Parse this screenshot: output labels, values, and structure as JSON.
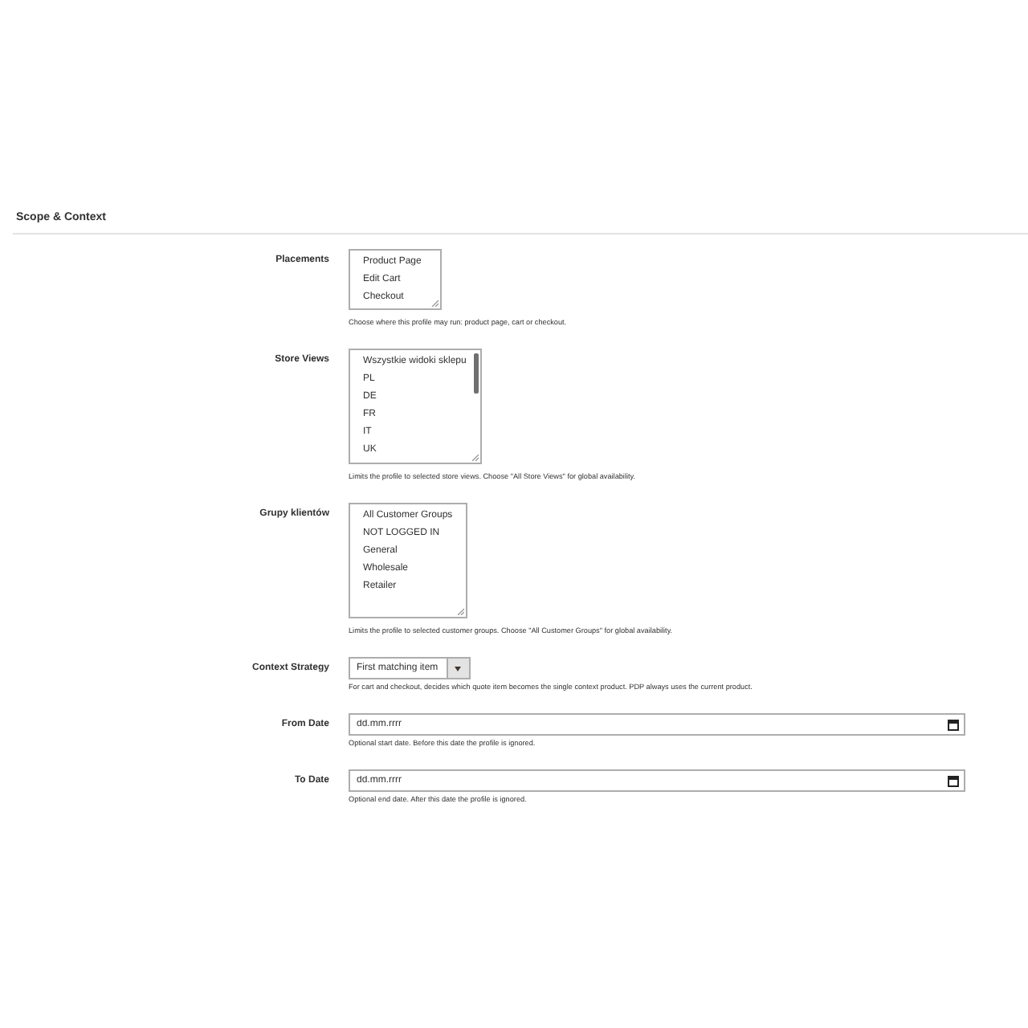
{
  "section": {
    "title": "Scope & Context"
  },
  "fields": [
    {
      "kind": "multiselect",
      "label": "Placements",
      "scrollable": false,
      "options": [
        {
          "label": "Product Page",
          "selected": false
        },
        {
          "label": "Edit Cart",
          "selected": false
        },
        {
          "label": "Checkout",
          "selected": false
        }
      ],
      "note": "Choose where this profile may run: product page, cart or checkout."
    },
    {
      "kind": "multiselect",
      "label": "Store Views",
      "scrollable": true,
      "options": [
        {
          "label": "Wszystkie widoki sklepu",
          "selected": false
        },
        {
          "label": "PL",
          "selected": false
        },
        {
          "label": "DE",
          "selected": false
        },
        {
          "label": "FR",
          "selected": false
        },
        {
          "label": "IT",
          "selected": false
        },
        {
          "label": "UK",
          "selected": false
        }
      ],
      "note": "Limits the profile to selected store views. Choose \"All Store Views\" for global availability."
    },
    {
      "kind": "multiselect",
      "label": "Grupy klientów",
      "scrollable": false,
      "options": [
        {
          "label": "All Customer Groups",
          "selected": false
        },
        {
          "label": "NOT LOGGED IN",
          "selected": false
        },
        {
          "label": "General",
          "selected": false
        },
        {
          "label": "Wholesale",
          "selected": false
        },
        {
          "label": "Retailer",
          "selected": false
        }
      ],
      "note": "Limits the profile to selected customer groups. Choose \"All Customer Groups\" for global availability."
    },
    {
      "kind": "select",
      "label": "Context Strategy",
      "value": "First matching item",
      "note": "For cart and checkout, decides which quote item becomes the single context product. PDP always uses the current product."
    },
    {
      "kind": "date",
      "label": "From Date",
      "placeholder": "dd.mm.rrrr",
      "note": "Optional start date. Before this date the profile is ignored."
    },
    {
      "kind": "date",
      "label": "To Date",
      "placeholder": "dd.mm.rrrr",
      "note": "Optional end date. After this date the profile is ignored."
    }
  ]
}
